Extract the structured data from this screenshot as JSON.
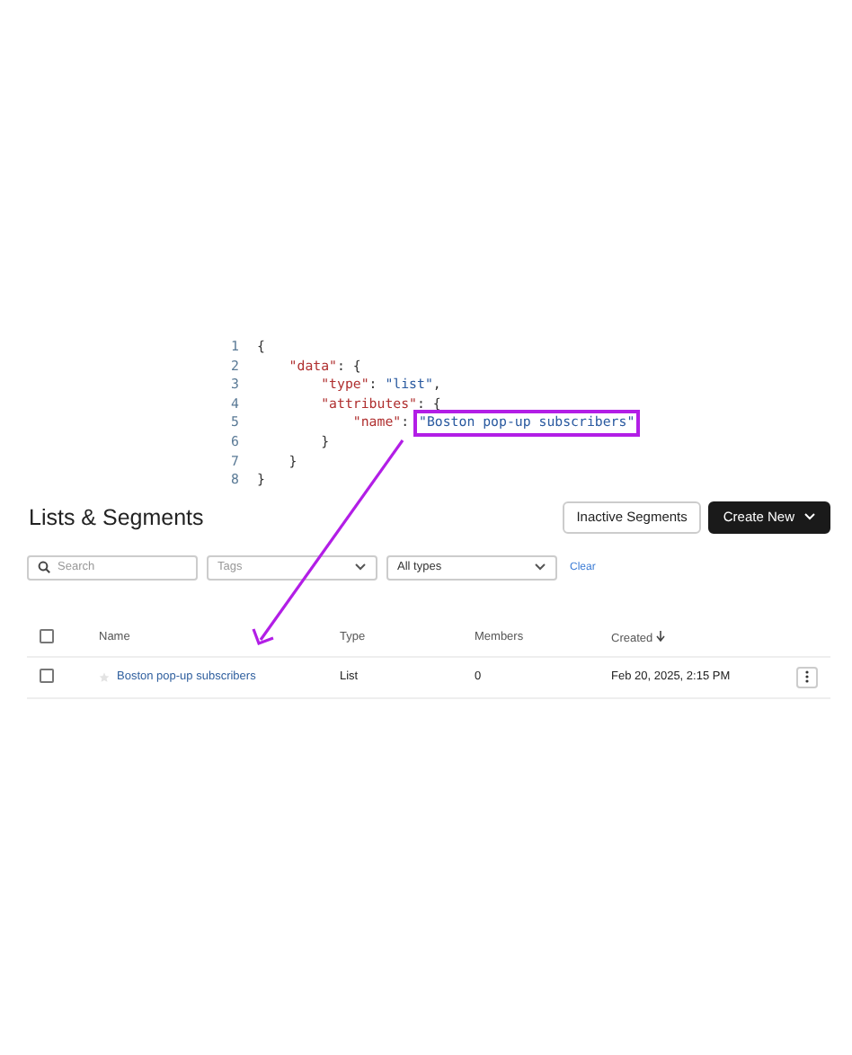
{
  "code_snippet": {
    "lines": [
      {
        "number": "1",
        "tokens": [
          {
            "kind": "punct",
            "text": "{"
          }
        ]
      },
      {
        "number": "2",
        "tokens": [
          {
            "kind": "key",
            "text": "    \"data\""
          },
          {
            "kind": "punct",
            "text": ": {"
          }
        ]
      },
      {
        "number": "3",
        "tokens": [
          {
            "kind": "key",
            "text": "        \"type\""
          },
          {
            "kind": "punct",
            "text": ": "
          },
          {
            "kind": "string",
            "text": "\"list\""
          },
          {
            "kind": "punct",
            "text": ","
          }
        ]
      },
      {
        "number": "4",
        "tokens": [
          {
            "kind": "key",
            "text": "        \"attributes\""
          },
          {
            "kind": "punct",
            "text": ": {"
          }
        ]
      },
      {
        "number": "5",
        "tokens": [
          {
            "kind": "key",
            "text": "            \"name\""
          },
          {
            "kind": "punct",
            "text": ": "
          },
          {
            "kind": "string",
            "text": "\"Boston pop-up subscribers\"",
            "highlighted": true
          }
        ]
      },
      {
        "number": "6",
        "tokens": [
          {
            "kind": "punct",
            "text": "        }"
          }
        ]
      },
      {
        "number": "7",
        "tokens": [
          {
            "kind": "punct",
            "text": "    }"
          }
        ]
      },
      {
        "number": "8",
        "tokens": [
          {
            "kind": "punct",
            "text": "}"
          }
        ]
      }
    ]
  },
  "page": {
    "title": "Lists & Segments",
    "buttons": [
      {
        "label": "Inactive Segments",
        "kind": "secondary"
      },
      {
        "label": "Create New",
        "kind": "primary"
      }
    ],
    "filters": {
      "search": {
        "placeholder": "Search"
      },
      "tags": {
        "placeholder": "Tags"
      },
      "type": {
        "value": "All types"
      },
      "clear": "Clear"
    },
    "table": {
      "all_selected": false,
      "columns": [
        "Name",
        "Type",
        "Members",
        "Created"
      ],
      "rows": [
        {
          "selected": false,
          "starred": false,
          "name": "Boston pop-up subscribers",
          "type": "List",
          "members": "0",
          "created": "Feb 20, 2025, 2:15 PM"
        }
      ]
    }
  }
}
